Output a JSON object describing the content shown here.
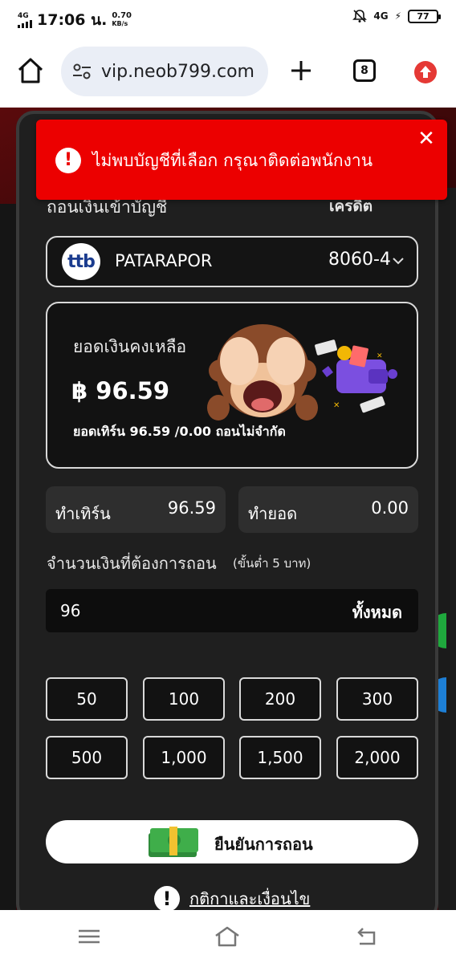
{
  "status_bar": {
    "network_left": "4G",
    "time": "17:06 น.",
    "speed_value": "0.70",
    "speed_unit": "KB/s",
    "network_right": "4G",
    "battery": "77"
  },
  "browser": {
    "url": "vip.neob799.com",
    "tab_count": "8"
  },
  "toast": {
    "message": "ไม่พบบัญชีที่เลือก กรุณาติดต่อพนักงาน",
    "close_symbol": "✕"
  },
  "withdraw": {
    "section_title": "ถอนเงินเข้าบัญชี",
    "credit_label": "เครดิต",
    "bank": {
      "logo_text": "ttb",
      "account_name": "PATARAPOR",
      "account_number": "8060-4"
    },
    "balance": {
      "label": "ยอดเงินคงเหลือ",
      "amount": "฿ 96.59",
      "note": "ยอดเทิร์น 96.59 /0.00 ถอนไม่จำกัด"
    },
    "stats": [
      {
        "label": "ทำเทิร์น",
        "value": "96.59"
      },
      {
        "label": "ทำยอด",
        "value": "0.00"
      }
    ],
    "amount_label": "จำนวนเงินที่ต้องการถอน",
    "amount_min": "(ขั้นต่ำ 5 บาท)",
    "amount_value": "96",
    "all_button": "ทั้งหมด",
    "quick_amounts": [
      "50",
      "100",
      "200",
      "300",
      "500",
      "1,000",
      "1,500",
      "2,000"
    ],
    "confirm_label": "ยืนยันการถอน",
    "terms_label": "กติกาและเงื่อนไข"
  }
}
